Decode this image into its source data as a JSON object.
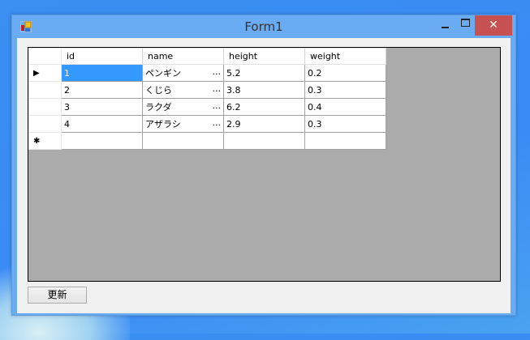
{
  "window": {
    "title": "Form1",
    "close_glyph": "✕"
  },
  "grid": {
    "columns": [
      "id",
      "name",
      "height",
      "weight"
    ],
    "rows": [
      {
        "id": "1",
        "name": "ペンギン",
        "height": "5.2",
        "weight": "0.2"
      },
      {
        "id": "2",
        "name": "くじら",
        "height": "3.8",
        "weight": "0.3"
      },
      {
        "id": "3",
        "name": "ラクダ",
        "height": "6.2",
        "weight": "0.4"
      },
      {
        "id": "4",
        "name": "アザラシ",
        "height": "2.9",
        "weight": "0.3"
      }
    ],
    "current_row_marker": "▶",
    "new_row_marker": "✱",
    "ellipsis": "..."
  },
  "buttons": {
    "update": "更新"
  }
}
